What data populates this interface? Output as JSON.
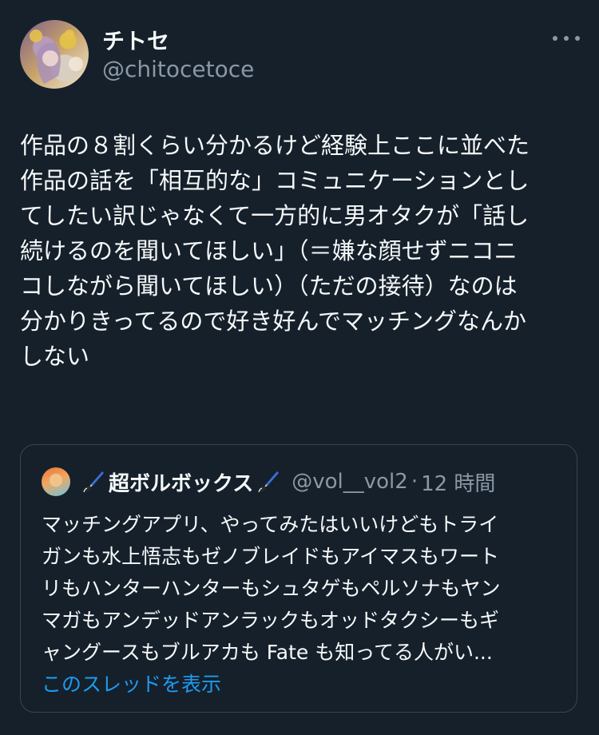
{
  "author": {
    "display_name": "チトセ",
    "handle": "@chitocetoce"
  },
  "tweet": {
    "text": "作品の８割くらい分かるけど経験上ここに並べた\n作品の話を「相互的な」コミュニケーションとし\nてしたい訳じゃなくて一方的に男オタクが「話し\n続けるのを聞いてほしい」（＝嫌な顔せずニコニ\nコしながら聞いてほしい）（ただの接待）なのは\n分かりきってるので好き好んでマッチングなんか\nしない"
  },
  "quote": {
    "name": "超ボルボックス",
    "handle": "@vol__vol2",
    "separator": "·",
    "time": "12 時間",
    "text": "マッチングアプリ、やってみたはいいけどもトライ\nガンも水上悟志もゼノブレイドもアイマスもワート\nリもハンターハンターもシュタゲもペルソナもヤン\nマガもアンデッドアンラックもオッドタクシーもギ\nャングースもブルアカも Fate も知ってる人がい...",
    "show_thread": "このスレッドを表示"
  },
  "icons": {
    "more": "more-horizontal-icon",
    "name_emoji": "paintbrush-icon"
  },
  "colors": {
    "background": "#15202b",
    "text": "#f7f9f9",
    "secondary": "#8b98a5",
    "link": "#1d9bf0",
    "border": "#38444d"
  }
}
